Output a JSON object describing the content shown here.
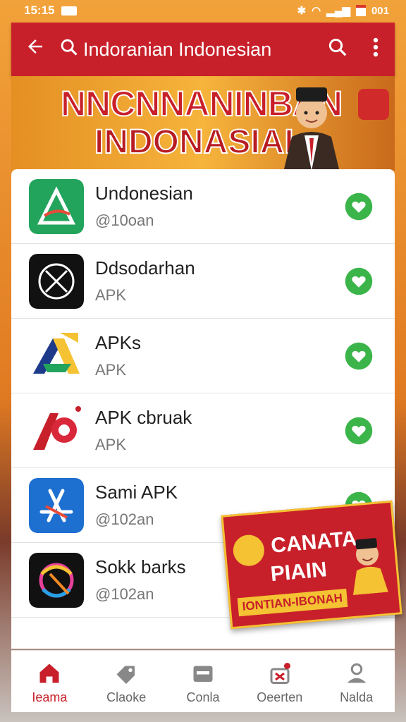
{
  "status_bar": {
    "time": "15:15",
    "battery": "001",
    "signal": "4G"
  },
  "app_bar": {
    "title": "Indoranian Indonesian",
    "back_icon": "arrow-left-icon",
    "search_icon": "search-icon",
    "menu_icon": "more-vert-icon"
  },
  "banner": {
    "line1": "NNCNNANINBAN",
    "line2": "INDONASIAI"
  },
  "apps": [
    {
      "name": "Undonesian",
      "sub": "@10oan",
      "icon_color": "#22a45d",
      "icon": "green-a-logo-icon"
    },
    {
      "name": "Ddsodarhan",
      "sub": "APK",
      "icon_color": "#111111",
      "icon": "circle-x-logo-icon"
    },
    {
      "name": "APKs",
      "sub": "APK",
      "icon_color": "#ffffff",
      "icon": "colorful-a-logo-icon"
    },
    {
      "name": "APK cbruak",
      "sub": "APK",
      "icon_color": "#ffffff",
      "icon": "red-ap-logo-icon"
    },
    {
      "name": "Sami APK",
      "sub": "@102an",
      "icon_color": "#1d6fd0",
      "icon": "app-store-logo-icon"
    },
    {
      "name": "Sokk barks",
      "sub": "@102an",
      "icon_color": "#111111",
      "icon": "ring-logo-icon"
    }
  ],
  "promo": {
    "line1": "CANATA",
    "line2": "PIAIN",
    "line3": "IONTIAN-IBONAH"
  },
  "bottom_nav": [
    {
      "label": "Ieama",
      "icon": "home-icon",
      "active": true
    },
    {
      "label": "Claoke",
      "icon": "tag-icon",
      "active": false
    },
    {
      "label": "Conla",
      "icon": "card-icon",
      "active": false
    },
    {
      "label": "Oeerten",
      "icon": "gift-icon",
      "active": false
    },
    {
      "label": "Nalda",
      "icon": "person-icon",
      "active": false
    }
  ],
  "colors": {
    "primary": "#c8202a",
    "heart": "#3bb54a",
    "accent": "#f4c233"
  }
}
